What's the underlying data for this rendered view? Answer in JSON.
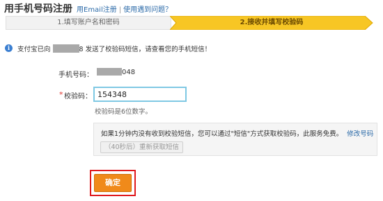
{
  "header": {
    "title": "用手机号码注册",
    "links": [
      "用Email注册",
      "使用遇到问题？"
    ]
  },
  "steps": [
    {
      "label": "1.填写账户名和密码",
      "active": false
    },
    {
      "label": "2.接收并填写校验码",
      "active": true
    }
  ],
  "info": {
    "prefix": "支付宝已向",
    "masked_suffix": "8",
    "message": " 发送了校验码短信，请查看您的手机短信！"
  },
  "phone": {
    "label": "手机号码：",
    "value_suffix": "048"
  },
  "code": {
    "required_mark": "*",
    "label": "校验码：",
    "value": "154348",
    "hint": "校验码是6位数字。"
  },
  "notice": {
    "text": "如果1分钟内没有收到校验短信，您可以通过\"短信\"方式获取校验码，此服务免费。",
    "link": "修改号码",
    "resend_label": "（40秒后）重新获取短信"
  },
  "confirm_label": "确定",
  "colors": {
    "accent_orange": "#f08a1a",
    "active_step": "#f7c624",
    "link_blue": "#2b6aa8",
    "highlight_red": "#e0191d"
  }
}
